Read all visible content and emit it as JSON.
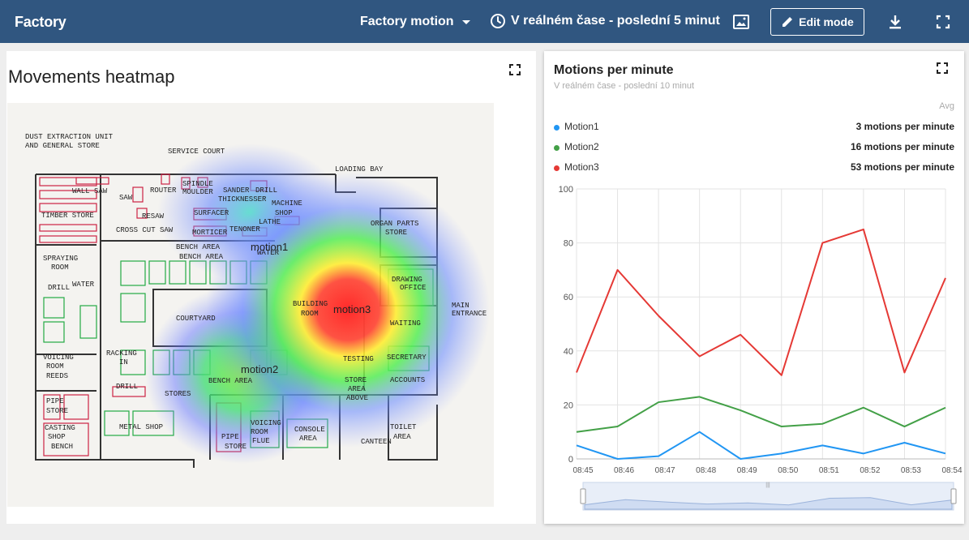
{
  "header": {
    "app_title": "Factory",
    "dashboard_name": "Factory motion",
    "time_range": "V reálném čase - poslední 5 minut",
    "edit_label": "Edit mode",
    "icons": [
      "clock-icon",
      "image-icon",
      "pencil-icon",
      "download-icon",
      "fullscreen-icon"
    ],
    "background": "#305680"
  },
  "heatmap": {
    "title": "Movements heatmap",
    "markers": [
      {
        "label": "motion1"
      },
      {
        "label": "motion2"
      },
      {
        "label": "motion3"
      }
    ],
    "plan_labels": [
      "DUST EXTRACTION UNIT",
      "AND GENERAL STORE",
      "SERVICE COURT",
      "LOADING BAY",
      "WALL SAW",
      "SAW",
      "ROUTER",
      "SPINDLE",
      "MOULDER",
      "SANDER",
      "THICKNESSER",
      "DRILL",
      "MACHINE",
      "SHOP",
      "TIMBER STORE",
      "RESAW",
      "SURFACER",
      "LATHE",
      "CROSS CUT SAW",
      "MORTICER",
      "TENONER",
      "ORGAN PARTS",
      "STORE",
      "WATER",
      "SPRAYING",
      "ROOM",
      "BENCH AREA",
      "DRAWING",
      "OFFICE",
      "DRILL",
      "WATER",
      "COURTYARD",
      "BUILDING",
      "ROOM",
      "WAITING",
      "MAIN",
      "ENTRANCE",
      "VOICING",
      "ROOM",
      "REEDS",
      "RACKING",
      "IN",
      "TESTING",
      "SECRETARY",
      "BENCH AREA",
      "ACCOUNTS",
      "STORE",
      "AREA",
      "ABOVE",
      "DRILL",
      "STORES",
      "PIPE",
      "STORE",
      "CASTING",
      "SHOP",
      "BENCH",
      "METAL SHOP",
      "PIPE",
      "STORE",
      "VOICING",
      "ROOM",
      "FLUE",
      "CONSOLE",
      "AREA",
      "CANTEEN",
      "TOILET",
      "AREA",
      "BENCH AREA"
    ]
  },
  "chart": {
    "title": "Motions per minute",
    "subtitle": "V reálném čase - poslední 10 minut",
    "legend_header": "Avg",
    "legend": [
      {
        "name": "Motion1",
        "value": "3 motions per minute",
        "color": "#2196f3"
      },
      {
        "name": "Motion2",
        "value": "16 motions per minute",
        "color": "#43a047"
      },
      {
        "name": "Motion3",
        "value": "53 motions per minute",
        "color": "#e53935"
      }
    ]
  },
  "chart_data": {
    "type": "line",
    "categories": [
      "08:45",
      "08:46",
      "08:47",
      "08:48",
      "08:49",
      "08:50",
      "08:51",
      "08:52",
      "08:53",
      "08:54"
    ],
    "ylim": [
      0,
      100
    ],
    "y_ticks": [
      0,
      20,
      40,
      60,
      80,
      100
    ],
    "grid": true,
    "legend_position": "top",
    "series": [
      {
        "name": "Motion1",
        "color": "#2196f3",
        "values": [
          5,
          0,
          1,
          10,
          0,
          2,
          5,
          2,
          6,
          2
        ]
      },
      {
        "name": "Motion2",
        "color": "#43a047",
        "values": [
          10,
          12,
          21,
          23,
          18,
          12,
          13,
          19,
          12,
          19
        ]
      },
      {
        "name": "Motion3",
        "color": "#e53935",
        "values": [
          32,
          70,
          53,
          38,
          46,
          31,
          80,
          85,
          32,
          67
        ]
      }
    ]
  }
}
